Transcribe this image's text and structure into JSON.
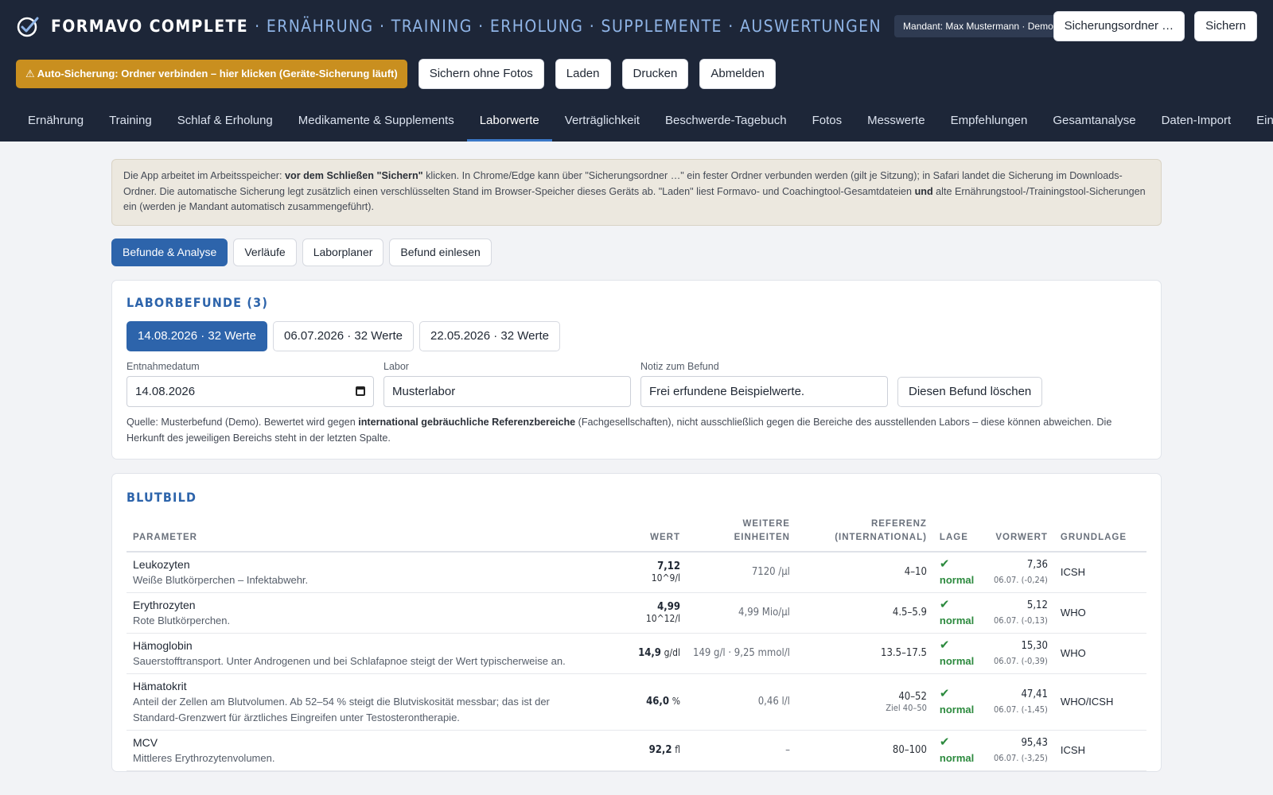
{
  "app": {
    "brand": "FORMAVO COMPLETE",
    "modules": "· ERNÄHRUNG · TRAINING · ERHOLUNG · SUPPLEMENTE · AUSWERTUNGEN",
    "tenant": "Mandant: Max Mustermann · Demo"
  },
  "top_buttons": {
    "backup_folder": "Sicherungsordner …",
    "save": "Sichern"
  },
  "toolbar": {
    "auto_backup": "⚠ Auto-Sicherung: Ordner verbinden – hier klicken (Geräte-Sicherung läuft)",
    "save_no_photos": "Sichern ohne Fotos",
    "load": "Laden",
    "print": "Drucken",
    "logout": "Abmelden"
  },
  "nav": [
    "Ernährung",
    "Training",
    "Schlaf & Erholung",
    "Medikamente & Supplements",
    "Laborwerte",
    "Verträglichkeit",
    "Beschwerde-Tagebuch",
    "Fotos",
    "Messwerte",
    "Empfehlungen",
    "Gesamtanalyse",
    "Daten-Import",
    "Ein"
  ],
  "info": {
    "p1": "Die App arbeitet im Arbeitsspeicher: ",
    "b1": "vor dem Schließen \"Sichern\"",
    "p2": " klicken. In Chrome/Edge kann über \"Sicherungsordner …\" ein fester Ordner verbunden werden (gilt je Sitzung); in Safari landet die Sicherung im Downloads-Ordner. Die automatische Sicherung legt zusätzlich einen verschlüsselten Stand im Browser-Speicher dieses Geräts ab. \"Laden\" liest Formavo- und Coachingtool-Gesamtdateien ",
    "b2": "und",
    "p3": " alte Ernährungstool-/Trainingstool-Sicherungen ein (werden je Mandant automatisch zusammengeführt)."
  },
  "subtabs": [
    "Befunde & Analyse",
    "Verläufe",
    "Laborplaner",
    "Befund einlesen"
  ],
  "reports": {
    "title": "LABORBEFUNDE (3)",
    "tabs": [
      "14.08.2026 · 32 Werte",
      "06.07.2026 · 32 Werte",
      "22.05.2026 · 32 Werte"
    ],
    "date_label": "Entnahmedatum",
    "date_value": "14.08.2026",
    "lab_label": "Labor",
    "lab_value": "Musterlabor",
    "note_label": "Notiz zum Befund",
    "note_value": "Frei erfundene Beispielwerte.",
    "delete": "Diesen Befund löschen",
    "source1": "Quelle: Musterbefund (Demo). Bewertet wird gegen ",
    "source_b": "international gebräuchliche Referenzbereiche",
    "source2": " (Fachgesellschaften), nicht ausschließlich gegen die Bereiche des ausstellenden Labors – diese können abweichen. Die Herkunft des jeweiligen Bereichs steht in der letzten Spalte."
  },
  "bloodcount": {
    "title": "BLUTBILD",
    "headers": {
      "param": "PARAMETER",
      "value": "WERT",
      "other_1": "WEITERE",
      "other_2": "EINHEITEN",
      "ref_1": "REFERENZ",
      "ref_2": "(INTERNATIONAL)",
      "status": "LAGE",
      "prev": "VORWERT",
      "basis": "GRUNDLAGE"
    },
    "rows": [
      {
        "name": "Leukozyten",
        "desc": "Weiße Blutkörperchen – Infektabwehr.",
        "value": "7,12",
        "unit": "10^9/l",
        "other": "7120 /µl",
        "ref": "4–10",
        "ref_note": "",
        "status": "normal",
        "prev": "7,36",
        "prev_note": "06.07. (-0,24)",
        "basis": "ICSH"
      },
      {
        "name": "Erythrozyten",
        "desc": "Rote Blutkörperchen.",
        "value": "4,99",
        "unit": "10^12/l",
        "other": "4,99 Mio/µl",
        "ref": "4.5–5.9",
        "ref_note": "",
        "status": "normal",
        "prev": "5,12",
        "prev_note": "06.07. (-0,13)",
        "basis": "WHO"
      },
      {
        "name": "Hämoglobin",
        "desc": "Sauerstofftransport. Unter Androgenen und bei Schlafapnoe steigt der Wert typischerweise an.",
        "value": "14,9",
        "unit": "g/dl",
        "other": "149 g/l · 9,25 mmol/l",
        "ref": "13.5–17.5",
        "ref_note": "",
        "status": "normal",
        "prev": "15,30",
        "prev_note": "06.07. (-0,39)",
        "basis": "WHO"
      },
      {
        "name": "Hämatokrit",
        "desc": "Anteil der Zellen am Blutvolumen. Ab 52–54 % steigt die Blutviskosität messbar; das ist der Standard-Grenzwert für ärztliches Eingreifen unter Testosterontherapie.",
        "value": "46,0",
        "unit": "%",
        "other": "0,46 l/l",
        "ref": "40–52",
        "ref_note": "Ziel 40–50",
        "status": "normal",
        "prev": "47,41",
        "prev_note": "06.07. (-1,45)",
        "basis": "WHO/ICSH"
      },
      {
        "name": "MCV",
        "desc": "Mittleres Erythrozytenvolumen.",
        "value": "92,2",
        "unit": "fl",
        "other": "–",
        "ref": "80–100",
        "ref_note": "",
        "status": "normal",
        "prev": "95,43",
        "prev_note": "06.07. (-3,25)",
        "basis": "ICSH"
      }
    ]
  },
  "colors": {
    "header_bg": "#1d2638",
    "accent": "#2d64ab",
    "warning": "#c98f1f",
    "normal": "#2c8a3e"
  },
  "icons": {
    "logo": "check-circle-logo-icon",
    "status_ok": "check-icon",
    "calendar": "calendar-icon"
  }
}
